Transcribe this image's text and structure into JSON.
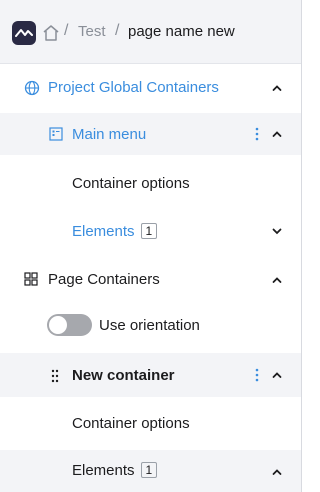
{
  "header": {
    "logo_icon": "app-logo",
    "home_icon": "home-icon",
    "breadcrumb": [
      "Test",
      "page name new"
    ],
    "separator": "/"
  },
  "tree": {
    "project_global": {
      "label": "Project Global Containers",
      "icon": "globe-icon",
      "expanded": true
    },
    "main_menu": {
      "label": "Main menu",
      "icon": "container-icon",
      "expanded": true
    },
    "main_menu_container_options": {
      "label": "Container options"
    },
    "main_menu_elements": {
      "label": "Elements",
      "count": "1",
      "expanded": false
    },
    "page_containers": {
      "label": "Page Containers",
      "icon": "grid-icon",
      "expanded": true
    },
    "use_orientation": {
      "label": "Use orientation",
      "on": false
    },
    "new_container": {
      "label": "New container",
      "icon": "drag-handle-icon",
      "expanded": true
    },
    "new_container_options": {
      "label": "Container options"
    },
    "new_container_elements": {
      "label": "Elements",
      "count": "1",
      "expanded": true
    }
  },
  "colors": {
    "accent": "#3a8dde",
    "header_bg": "#f3f4f7",
    "logo_bg": "#2a2a44"
  }
}
